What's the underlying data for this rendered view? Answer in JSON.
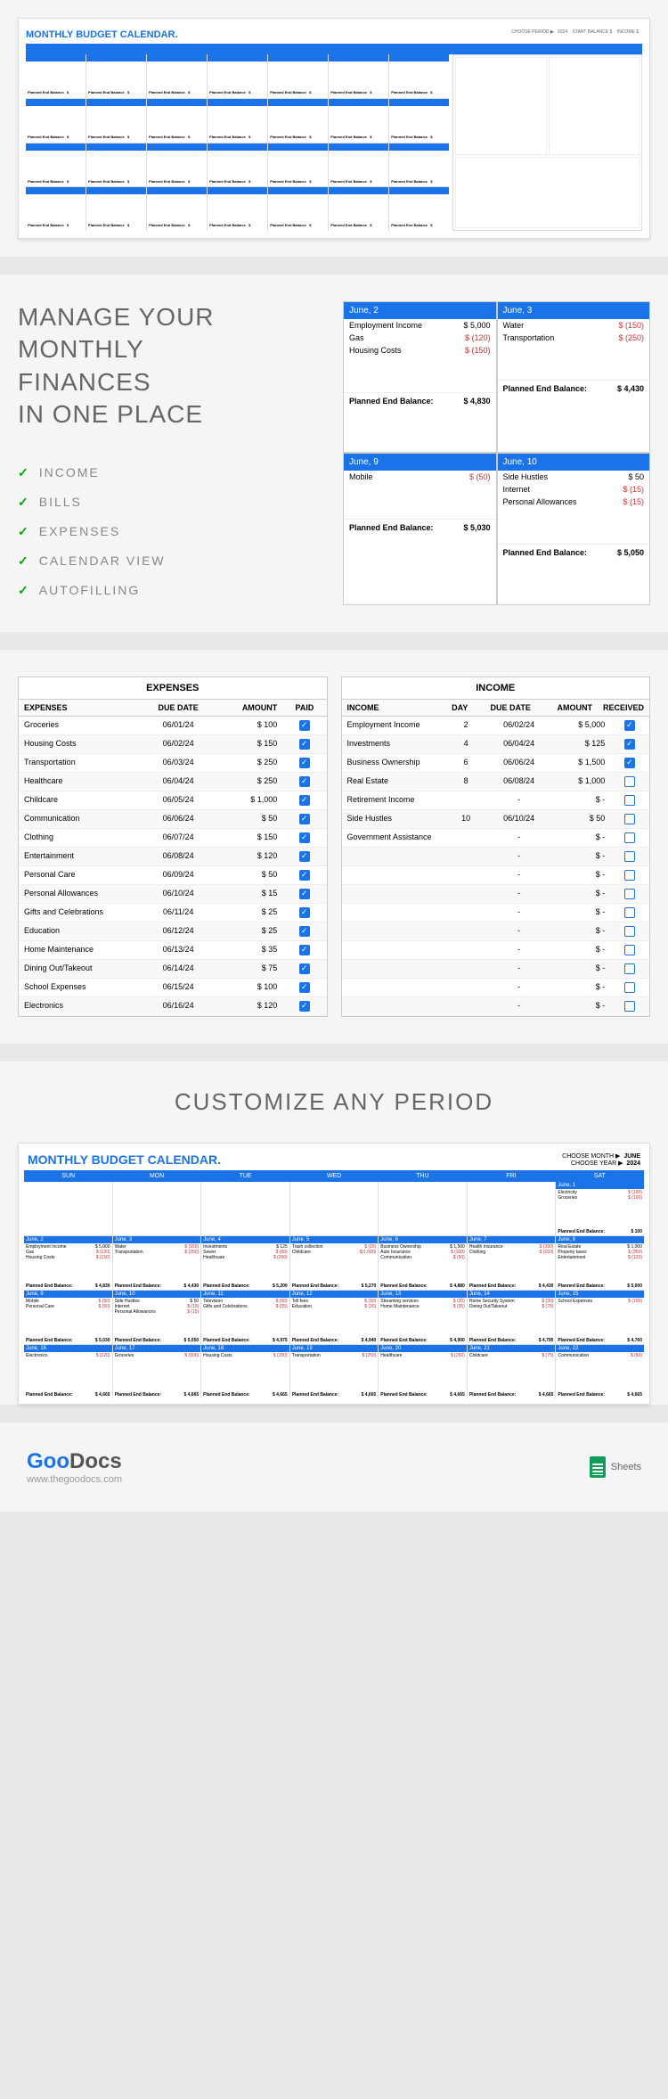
{
  "hero_title": "MONTHLY BUDGET CALENDAR.",
  "feat": {
    "title_l1": "MANAGE YOUR",
    "title_l2": "MONTHLY",
    "title_l3": "FINANCES",
    "title_l4": "IN ONE PLACE",
    "items": [
      "INCOME",
      "BILLS",
      "EXPENSES",
      "CALENDAR VIEW",
      "AUTOFILLING"
    ]
  },
  "days": [
    {
      "hdr": "June, 2",
      "rows": [
        [
          "Employment Income",
          "$ 5,000"
        ],
        [
          "Gas",
          "$  (120)"
        ],
        [
          "Housing Costs",
          "$  (150)"
        ]
      ],
      "foot_l": "Planned End Balance:",
      "foot_v": "$ 4,830"
    },
    {
      "hdr": "June, 3",
      "rows": [
        [
          "Water",
          "$  (150)"
        ],
        [
          "Transportation",
          "$  (250)"
        ]
      ],
      "foot_l": "Planned End Balance:",
      "foot_v": "$ 4,430"
    },
    {
      "hdr": "June, 9",
      "rows": [
        [
          "Mobile",
          "$   (50)"
        ]
      ],
      "foot_l": "Planned End Balance:",
      "foot_v": "$ 5,030"
    },
    {
      "hdr": "June, 10",
      "rows": [
        [
          "Side Hustles",
          "$    50"
        ],
        [
          "Internet",
          "$   (15)"
        ],
        [
          "Personal Allowances",
          "$   (15)"
        ]
      ],
      "foot_l": "Planned End Balance:",
      "foot_v": "$ 5,050"
    }
  ],
  "expenses": {
    "title": "EXPENSES",
    "cols": [
      "EXPENSES",
      "DUE DATE",
      "AMOUNT",
      "PAID"
    ],
    "rows": [
      [
        "Groceries",
        "06/01/24",
        "$    100",
        true
      ],
      [
        "Housing Costs",
        "06/02/24",
        "$    150",
        true
      ],
      [
        "Transportation",
        "06/03/24",
        "$    250",
        true
      ],
      [
        "Healthcare",
        "06/04/24",
        "$    250",
        true
      ],
      [
        "Childcare",
        "06/05/24",
        "$  1,000",
        true
      ],
      [
        "Communication",
        "06/06/24",
        "$     50",
        true
      ],
      [
        "Clothing",
        "06/07/24",
        "$    150",
        true
      ],
      [
        "Entertainment",
        "06/08/24",
        "$    120",
        true
      ],
      [
        "Personal Care",
        "06/09/24",
        "$     50",
        true
      ],
      [
        "Personal Allowances",
        "06/10/24",
        "$     15",
        true
      ],
      [
        "Gifts and Celebrations",
        "06/11/24",
        "$     25",
        true
      ],
      [
        "Education",
        "06/12/24",
        "$     25",
        true
      ],
      [
        "Home Maintenance",
        "06/13/24",
        "$     35",
        true
      ],
      [
        "Dining Out/Takeout",
        "06/14/24",
        "$     75",
        true
      ],
      [
        "School Expenses",
        "06/15/24",
        "$    100",
        true
      ],
      [
        "Electronics",
        "06/16/24",
        "$    120",
        true
      ]
    ]
  },
  "income": {
    "title": "INCOME",
    "cols": [
      "INCOME",
      "DAY",
      "DUE DATE",
      "AMOUNT",
      "RECEIVED"
    ],
    "rows": [
      [
        "Employment Income",
        "2",
        "06/02/24",
        "$   5,000",
        true
      ],
      [
        "Investments",
        "4",
        "06/04/24",
        "$     125",
        true
      ],
      [
        "Business Ownership",
        "6",
        "06/06/24",
        "$   1,500",
        true
      ],
      [
        "Real Estate",
        "8",
        "06/08/24",
        "$   1,000",
        false
      ],
      [
        "Retirement Income",
        "",
        "-",
        "$        -",
        false
      ],
      [
        "Side Hustles",
        "10",
        "06/10/24",
        "$      50",
        false
      ],
      [
        "Government Assistance",
        "",
        "-",
        "$        -",
        false
      ],
      [
        "",
        "",
        "-",
        "$        -",
        false
      ],
      [
        "",
        "",
        "-",
        "$        -",
        false
      ],
      [
        "",
        "",
        "-",
        "$        -",
        false
      ],
      [
        "",
        "",
        "-",
        "$        -",
        false
      ],
      [
        "",
        "",
        "-",
        "$        -",
        false
      ],
      [
        "",
        "",
        "-",
        "$        -",
        false
      ],
      [
        "",
        "",
        "-",
        "$        -",
        false
      ],
      [
        "",
        "",
        "-",
        "$        -",
        false
      ],
      [
        "",
        "",
        "-",
        "$        -",
        false
      ]
    ]
  },
  "customize_title": "CUSTOMIZE ANY PERIOD",
  "mini": {
    "title": "MONTHLY BUDGET CALENDAR.",
    "choose_m_l": "CHOOSE MONTH ▶",
    "choose_m_v": "JUNE",
    "choose_y_l": "CHOOSE YEAR ▶",
    "choose_y_v": "2024",
    "dow": [
      "SUN",
      "MON",
      "TUE",
      "WED",
      "THU",
      "FRI",
      "SAT"
    ],
    "cells": [
      {
        "h": "",
        "lines": [],
        "f": [
          "",
          ""
        ]
      },
      {
        "h": "",
        "lines": [],
        "f": [
          "",
          ""
        ]
      },
      {
        "h": "",
        "lines": [],
        "f": [
          "",
          ""
        ]
      },
      {
        "h": "",
        "lines": [],
        "f": [
          "",
          ""
        ]
      },
      {
        "h": "",
        "lines": [],
        "f": [
          "",
          ""
        ]
      },
      {
        "h": "",
        "lines": [],
        "f": [
          "",
          ""
        ]
      },
      {
        "h": "June, 1",
        "lines": [
          [
            "Electricity",
            "$ (100)",
            1
          ],
          [
            "Groceries",
            "$ (100)",
            1
          ]
        ],
        "f": [
          "Planned End Balance:",
          "$ 100"
        ]
      },
      {
        "h": "June, 2",
        "lines": [
          [
            "Employment Income",
            "$ 5,000",
            0
          ],
          [
            "Gas",
            "$ (120)",
            1
          ],
          [
            "Housing Costs",
            "$ (150)",
            1
          ]
        ],
        "f": [
          "Planned End Balance:",
          "$ 4,830"
        ]
      },
      {
        "h": "June, 3",
        "lines": [
          [
            "Water",
            "$ (150)",
            1
          ],
          [
            "Transportation",
            "$ (250)",
            1
          ]
        ],
        "f": [
          "Planned End Balance:",
          "$ 4,430"
        ]
      },
      {
        "h": "June, 4",
        "lines": [
          [
            "Investments",
            "$ 125",
            0
          ],
          [
            "Sewer",
            "$ (50)",
            1
          ],
          [
            "Healthcare",
            "$ (250)",
            1
          ]
        ],
        "f": [
          "Planned End Balance:",
          "$ 5,200"
        ]
      },
      {
        "h": "June, 5",
        "lines": [
          [
            "Trash collection",
            "$ (15)",
            1
          ],
          [
            "Childcare",
            "$(1,000)",
            1
          ]
        ],
        "f": [
          "Planned End Balance:",
          "$ 5,270"
        ]
      },
      {
        "h": "June, 6",
        "lines": [
          [
            "Business Ownership",
            "$ 1,500",
            0
          ],
          [
            "Auto Insurance",
            "$ (300)",
            1
          ],
          [
            "Communication",
            "$ (50)",
            1
          ]
        ],
        "f": [
          "Planned End Balance:",
          "$ 4,880"
        ]
      },
      {
        "h": "June, 7",
        "lines": [
          [
            "Health Insurance",
            "$ (300)",
            1
          ],
          [
            "Clothing",
            "$ (150)",
            1
          ]
        ],
        "f": [
          "Planned End Balance:",
          "$ 4,430"
        ]
      },
      {
        "h": "June, 8",
        "lines": [
          [
            "Real Estate",
            "$ 1,000",
            0
          ],
          [
            "Property taxes",
            "$ (350)",
            1
          ],
          [
            "Entertainment",
            "$ (120)",
            1
          ]
        ],
        "f": [
          "Planned End Balance:",
          "$ 5,000"
        ]
      },
      {
        "h": "June, 9",
        "lines": [
          [
            "Mobile",
            "$ (50)",
            1
          ],
          [
            "Personal Care",
            "$ (50)",
            1
          ]
        ],
        "f": [
          "Planned End Balance:",
          "$ 5,030"
        ]
      },
      {
        "h": "June, 10",
        "lines": [
          [
            "Side Hustles",
            "$ 50",
            0
          ],
          [
            "Internet",
            "$ (15)",
            1
          ],
          [
            "Personal Allowances",
            "$ (15)",
            1
          ]
        ],
        "f": [
          "Planned End Balance:",
          "$ 5,050"
        ]
      },
      {
        "h": "June, 11",
        "lines": [
          [
            "Television",
            "$ (50)",
            1
          ],
          [
            "Gifts and Celebrations",
            "$ (25)",
            1
          ]
        ],
        "f": [
          "Planned End Balance:",
          "$ 4,975"
        ]
      },
      {
        "h": "June, 12",
        "lines": [
          [
            "Toll fees",
            "$ (10)",
            1
          ],
          [
            "Education",
            "$ (25)",
            1
          ]
        ],
        "f": [
          "Planned End Balance:",
          "$ 4,940"
        ]
      },
      {
        "h": "June, 13",
        "lines": [
          [
            "Streaming services",
            "$ (20)",
            1
          ],
          [
            "Home Maintenance",
            "$ (35)",
            1
          ]
        ],
        "f": [
          "Planned End Balance:",
          "$ 4,900"
        ]
      },
      {
        "h": "June, 14",
        "lines": [
          [
            "Home Security System",
            "$ (30)",
            1
          ],
          [
            "Dining Out/Takeout",
            "$ (75)",
            1
          ]
        ],
        "f": [
          "Planned End Balance:",
          "$ 4,795"
        ]
      },
      {
        "h": "June, 15",
        "lines": [
          [
            "School Expenses",
            "$ (100)",
            1
          ]
        ],
        "f": [
          "Planned End Balance:",
          "$ 4,760"
        ]
      },
      {
        "h": "June, 16",
        "lines": [
          [
            "Electronics",
            "$ (120)",
            1
          ]
        ],
        "f": [
          "Planned End Balance:",
          "$ 4,665"
        ]
      },
      {
        "h": "June, 17",
        "lines": [
          [
            "Groceries",
            "$ (100)",
            1
          ]
        ],
        "f": [
          "Planned End Balance:",
          "$ 4,665"
        ]
      },
      {
        "h": "June, 18",
        "lines": [
          [
            "Housing Costs",
            "$ (150)",
            1
          ]
        ],
        "f": [
          "Planned End Balance:",
          "$ 4,665"
        ]
      },
      {
        "h": "June, 19",
        "lines": [
          [
            "Transportation",
            "$ (250)",
            1
          ]
        ],
        "f": [
          "Planned End Balance:",
          "$ 4,665"
        ]
      },
      {
        "h": "June, 20",
        "lines": [
          [
            "Healthcare",
            "$ (250)",
            1
          ]
        ],
        "f": [
          "Planned End Balance:",
          "$ 4,665"
        ]
      },
      {
        "h": "June, 21",
        "lines": [
          [
            "Childcare",
            "$ (75)",
            1
          ]
        ],
        "f": [
          "Planned End Balance:",
          "$ 4,665"
        ]
      },
      {
        "h": "June, 22",
        "lines": [
          [
            "Communication",
            "$ (50)",
            1
          ]
        ],
        "f": [
          "Planned End Balance:",
          "$ 4,665"
        ]
      }
    ]
  },
  "footer": {
    "brand1": "Goo",
    "brand2": "Docs",
    "url": "www.thegoodocs.com",
    "sheets": "Sheets"
  }
}
